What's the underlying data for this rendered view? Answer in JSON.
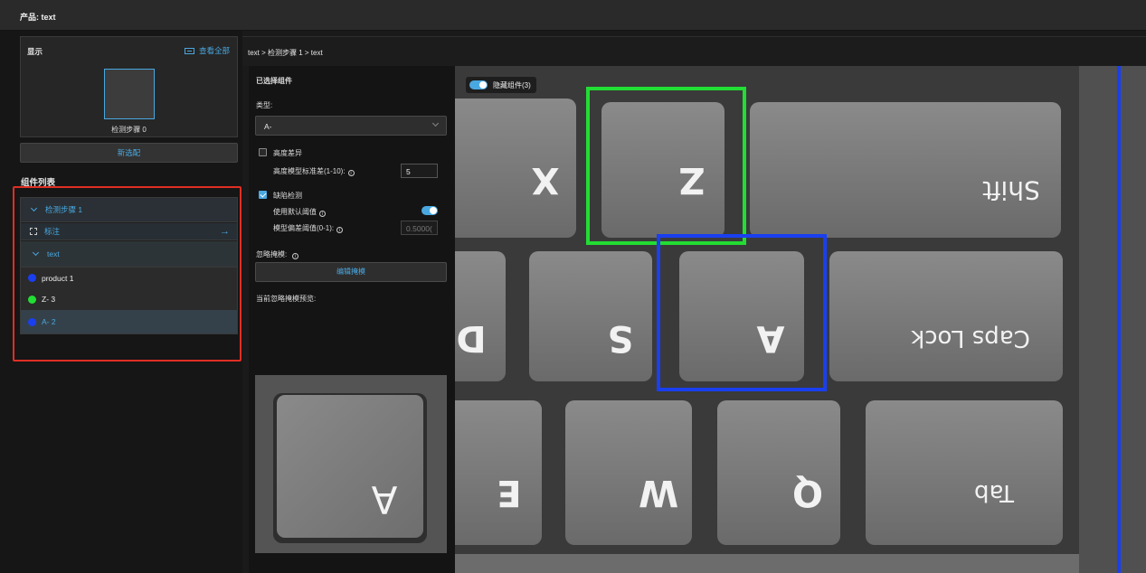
{
  "header": {
    "product_label": "产品: text"
  },
  "display": {
    "title": "显示",
    "view_all": "查看全部",
    "thumbnail_label": "检测步骤 0",
    "new_config": "新选配"
  },
  "components": {
    "title": "组件列表",
    "step": "检测步骤 1",
    "annotation": "标注",
    "text_node": "text",
    "items": [
      {
        "label": "product 1",
        "color": "#1a3ff0"
      },
      {
        "label": "Z- 3",
        "color": "#22dd33"
      },
      {
        "label": "A- 2",
        "color": "#1a3ff0"
      }
    ]
  },
  "breadcrumb": "text > 检测步骤 1 > text",
  "props": {
    "selected_title": "已选择组件",
    "type_label": "类型:",
    "type_value": "A-",
    "height_diff": "高度差异",
    "height_std": "高度模型标准差(1-10):",
    "height_std_value": "5",
    "defect_detect": "缺陷检测",
    "use_default": "使用默认阈值",
    "model_bias": "模型偏差阈值(0-1):",
    "model_bias_value": "0.5000(",
    "ignore_mask": "忽略掩模:",
    "edit_mask": "编辑掩模",
    "mask_preview": "当前忽略掩模预览:"
  },
  "canvas": {
    "hide_components": "隐藏组件(3)",
    "key_labels": [
      "X",
      "Z",
      "Shift",
      "D",
      "S",
      "A",
      "Caps Lock",
      "E",
      "W",
      "Q",
      "Tab"
    ],
    "preview_key": "A",
    "box_colors": {
      "z": "#22dd33",
      "a": "#1a3ff0",
      "line": "#1a3ff0"
    }
  }
}
